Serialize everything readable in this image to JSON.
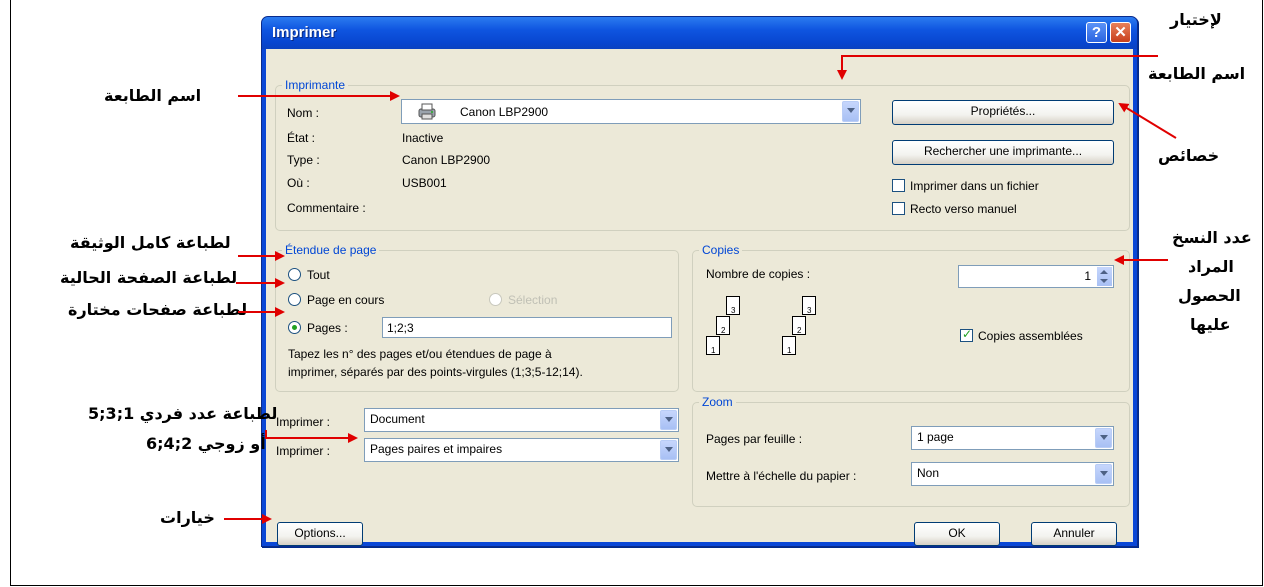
{
  "dialog": {
    "title": "Imprimer",
    "help_label": "?",
    "close_label": "✕"
  },
  "printer": {
    "group_label": "Imprimante",
    "name_label": "Nom :",
    "name_value": "Canon LBP2900",
    "state_label": "État :",
    "state_value": "Inactive",
    "type_label": "Type :",
    "type_value": "Canon LBP2900",
    "where_label": "Où :",
    "where_value": "USB001",
    "comment_label": "Commentaire :",
    "properties_button": "Propriétés...",
    "find_printer_button": "Rechercher une imprimante...",
    "print_to_file_label": "Imprimer dans un fichier",
    "print_to_file_checked": false,
    "manual_duplex_label": "Recto verso manuel",
    "manual_duplex_checked": false
  },
  "page_range": {
    "group_label": "Étendue de page",
    "all_label": "Tout",
    "current_label": "Page en cours",
    "selection_label": "Sélection",
    "pages_label": "Pages :",
    "pages_value": "1;2;3",
    "selected": "pages",
    "hint_line1": "Tapez les n° des pages et/ou étendues de page à",
    "hint_line2": "imprimer, séparés par des points-virgules (1;3;5-12;14)."
  },
  "copies": {
    "group_label": "Copies",
    "count_label": "Nombre de copies :",
    "count_value": "1",
    "collate_label": "Copies assemblées",
    "collate_checked": true,
    "stack_labels": [
      "3",
      "2",
      "1"
    ]
  },
  "print_what": {
    "label": "Imprimer :",
    "value": "Document"
  },
  "print_pages": {
    "label": "Imprimer :",
    "value": "Pages paires et impaires"
  },
  "zoom": {
    "group_label": "Zoom",
    "pages_per_sheet_label": "Pages par feuille :",
    "pages_per_sheet_value": "1 page",
    "scale_label": "Mettre à l'échelle du papier :",
    "scale_value": "Non"
  },
  "buttons": {
    "options": "Options...",
    "ok": "OK",
    "cancel": "Annuler"
  },
  "annotations": {
    "choose_printer_1": "لإختيار",
    "choose_printer_2": "اسم الطابعة",
    "printer_name": "اسم الطابعة",
    "properties": "خصائص",
    "print_all": "لطباعة كامل الوثيقة",
    "print_current": "لطباعة الصفحة الحالية",
    "print_selected": "لطباعة صفحات مختارة",
    "copies_1": "عدد النسخ",
    "copies_2": "المراد",
    "copies_3": "الحصول",
    "copies_4": "عليها",
    "odd_even_1": "لطباعة عدد فردي 1;3;5",
    "odd_even_2": "أو زوجي 2;4;6",
    "options": "خيارات"
  },
  "colors": {
    "title_bar": "#0a47d6",
    "dialog_bg": "#ece9d8",
    "group_label": "#0046d5",
    "arrow": "#e00000"
  }
}
